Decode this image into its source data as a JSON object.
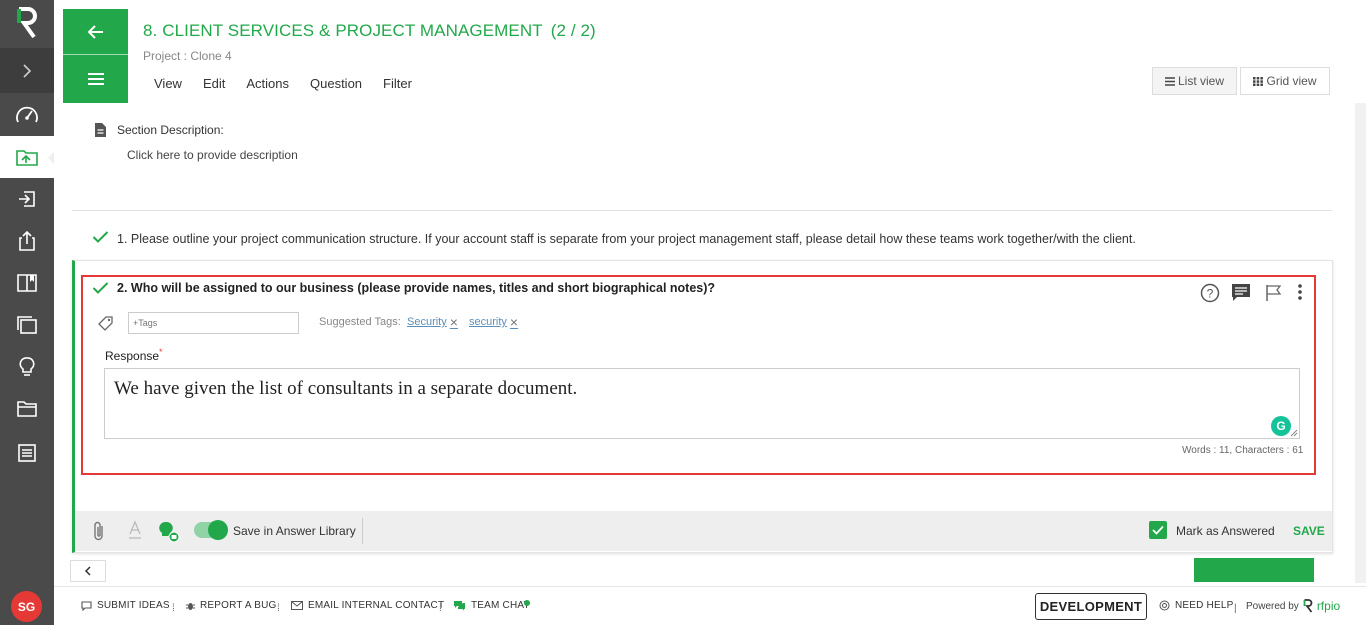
{
  "header": {
    "title": "8. CLIENT SERVICES & PROJECT MANAGEMENT",
    "count": "(2 / 2)",
    "subtitle": "Project : Clone 4",
    "menu": [
      "View",
      "Edit",
      "Actions",
      "Question",
      "Filter"
    ],
    "list_view_label": "List view",
    "grid_view_label": "Grid view"
  },
  "section": {
    "description_label": "Section Description:",
    "description_placeholder": "Click here to provide description"
  },
  "questions": [
    {
      "text": "1. Please outline your project communication structure. If your account staff is separate from your project management staff, please detail how these teams work together/with the client."
    },
    {
      "text": "2. Who will be assigned to our business (please provide names, titles and short biographical notes)?"
    }
  ],
  "editor": {
    "tags_placeholder": "+Tags",
    "suggested_label": "Suggested Tags:",
    "suggested_tags": [
      "Security",
      "security"
    ],
    "response_label": "Response",
    "required_mark": "*",
    "response_text": "We have given the list of consultants in a separate document.",
    "word_count": "Words : 11, Characters : 61"
  },
  "card_footer": {
    "save_library_label": "Save in Answer Library",
    "save_library_on": true,
    "mark_answered_label": "Mark as Answered",
    "mark_answered_checked": true,
    "save_label": "SAVE"
  },
  "bottom": {
    "avatar_initials": "SG",
    "submit_ideas": "SUBMIT IDEAS",
    "report_bug": "REPORT A BUG",
    "email_contact": "EMAIL INTERNAL CONTACT",
    "team_chat": "TEAM CHAT",
    "environment": "DEVELOPMENT",
    "need_help": "NEED HELP",
    "powered_by": "Powered by",
    "brand": "rfpio"
  },
  "colors": {
    "accent": "#22a84a",
    "sidebar": "#4a4a4a",
    "highlight": "#e53935"
  },
  "icons": {
    "sidebar": [
      "dashboard-icon",
      "projects-icon",
      "import-icon",
      "export-icon",
      "library-icon",
      "documents-icon",
      "ideas-icon",
      "folder-icon",
      "reports-icon"
    ]
  }
}
